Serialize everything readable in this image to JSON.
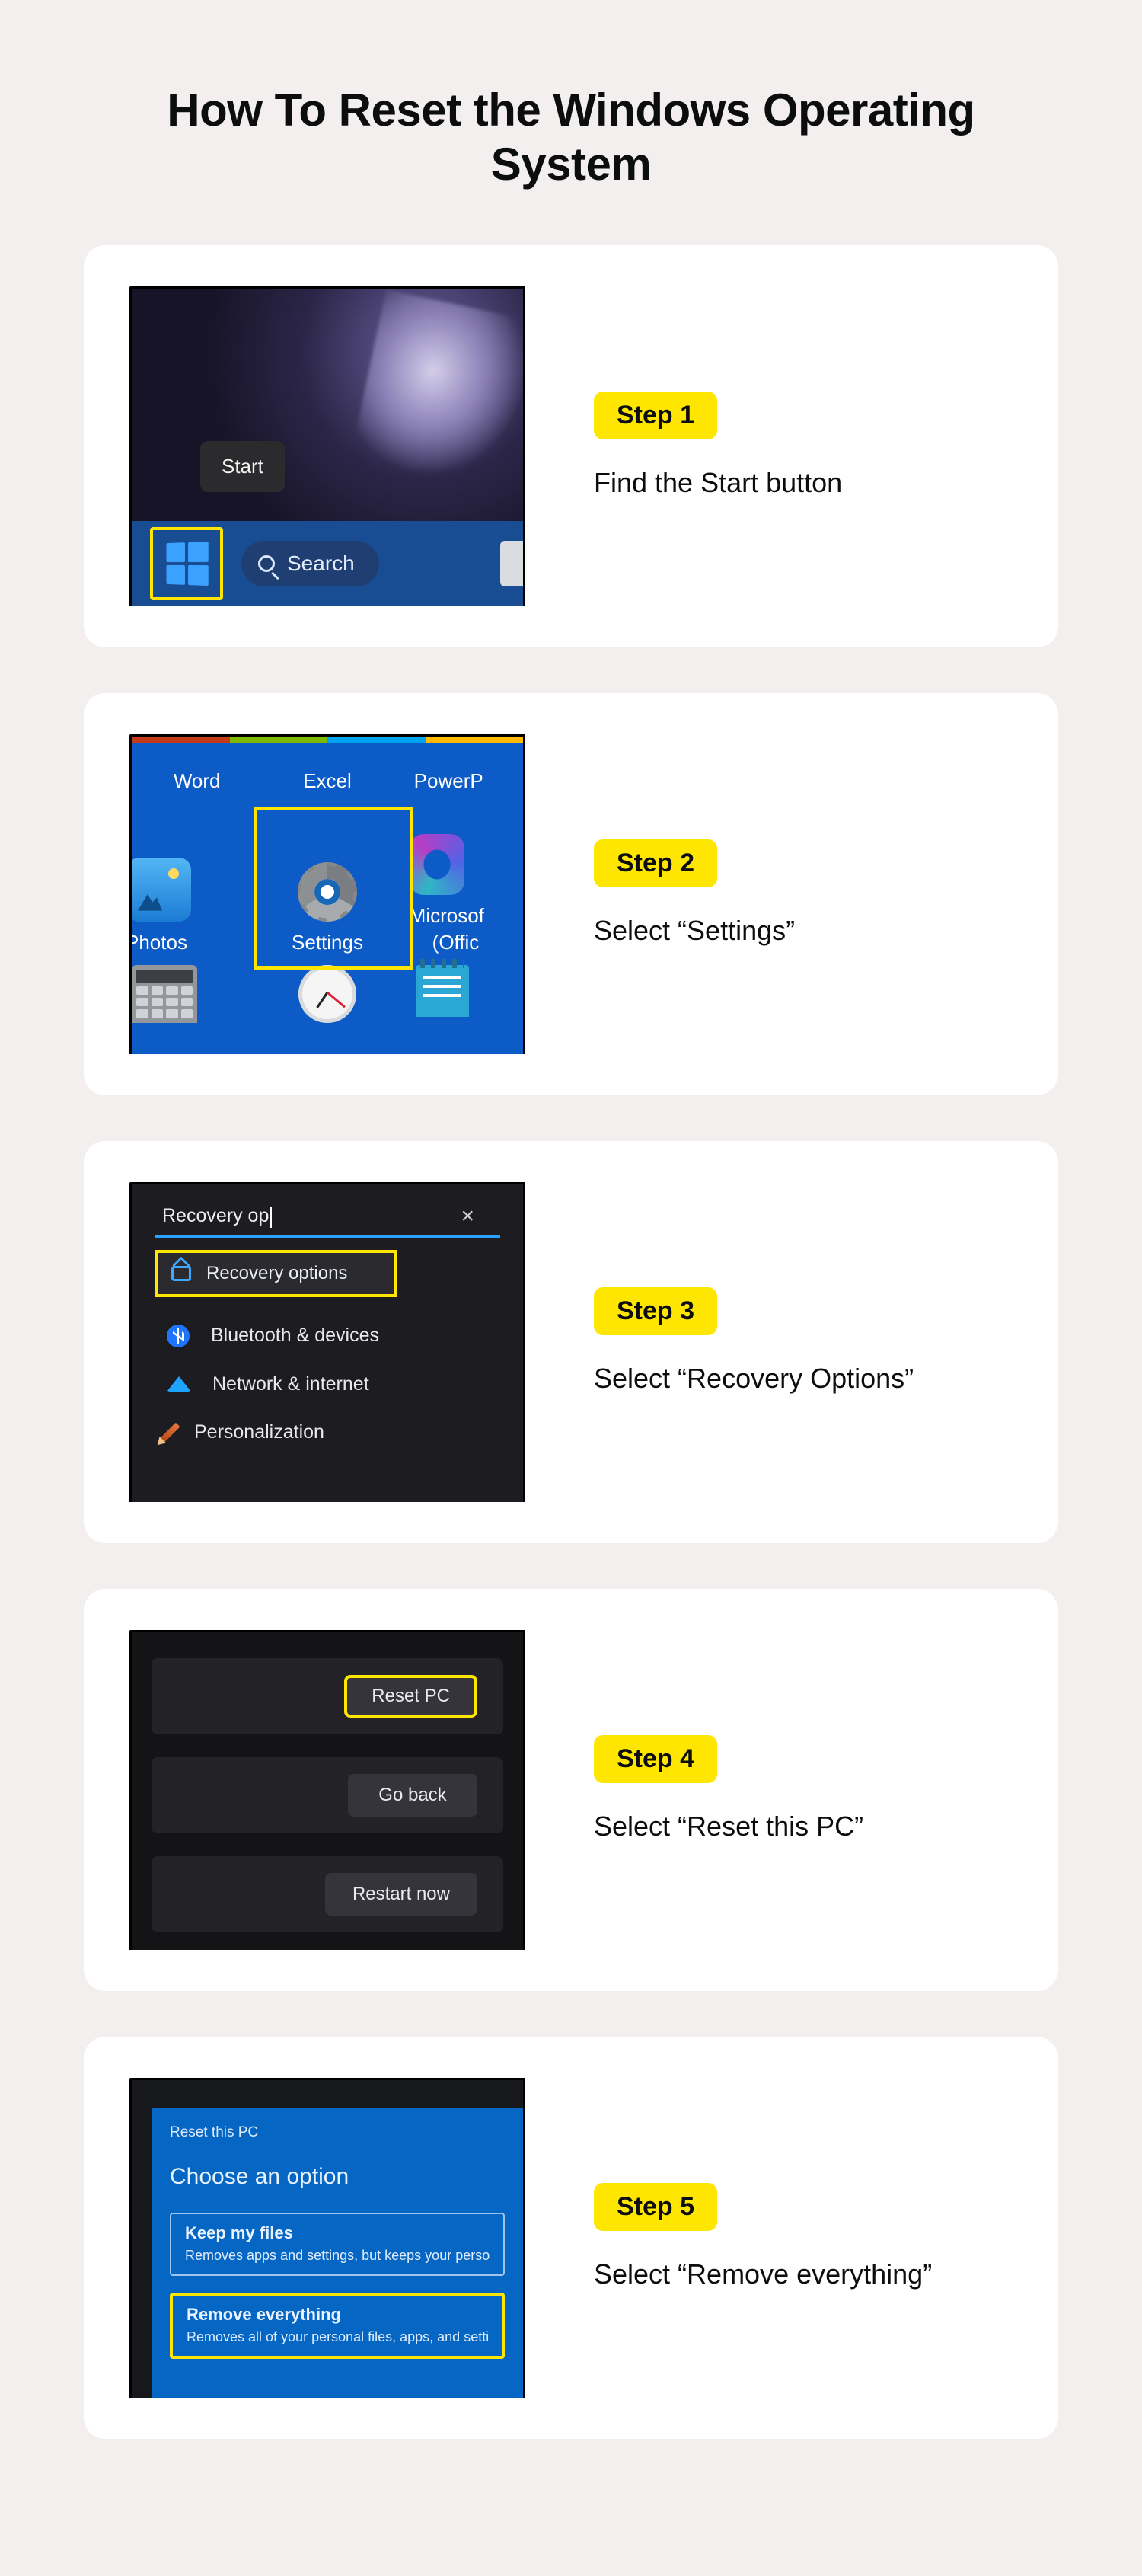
{
  "title": "How To Reset the Windows Operating System",
  "steps": [
    {
      "badge": "Step 1",
      "desc": "Find the Start button"
    },
    {
      "badge": "Step 2",
      "desc": "Select “Settings”"
    },
    {
      "badge": "Step 3",
      "desc": "Select “Recovery Options”"
    },
    {
      "badge": "Step 4",
      "desc": "Select “Reset this PC”"
    },
    {
      "badge": "Step 5",
      "desc": "Select “Remove everything”"
    }
  ],
  "step1": {
    "tooltip": "Start",
    "search": "Search"
  },
  "step2": {
    "apps_row1": [
      "Word",
      "Excel",
      "PowerP"
    ],
    "apps_row2_left": "Photos",
    "settings": "Settings",
    "apps_row2_right_line1": "Microsof",
    "apps_row2_right_line2": "(Offic"
  },
  "step3": {
    "query": "Recovery op",
    "result": "Recovery options",
    "items": [
      "Bluetooth & devices",
      "Network & internet",
      "Personalization"
    ]
  },
  "step4": {
    "buttons": [
      "Reset PC",
      "Go back",
      "Restart now"
    ]
  },
  "step5": {
    "crumb": "Reset this PC",
    "heading": "Choose an option",
    "opt1_title": "Keep my files",
    "opt1_desc": "Removes apps and settings, but keeps your personal files",
    "opt2_title": "Remove everything",
    "opt2_desc": "Removes all of your personal files, apps, and settings."
  }
}
